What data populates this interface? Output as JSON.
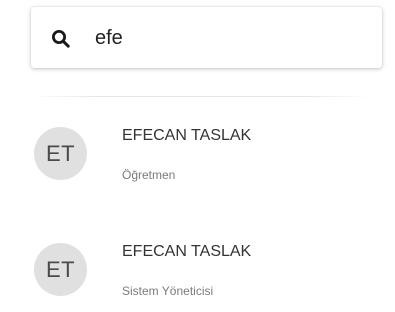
{
  "search": {
    "value": "efe",
    "icon": "search-icon"
  },
  "results": [
    {
      "initials": "ET",
      "name": "EFECAN TASLAK",
      "role": "Öğretmen"
    },
    {
      "initials": "ET",
      "name": "EFECAN TASLAK",
      "role": "Sistem Yöneticisi"
    }
  ],
  "colors": {
    "avatar_background": "#e0e0e0",
    "name_text": "#333333",
    "role_text": "#7a7a7a"
  }
}
